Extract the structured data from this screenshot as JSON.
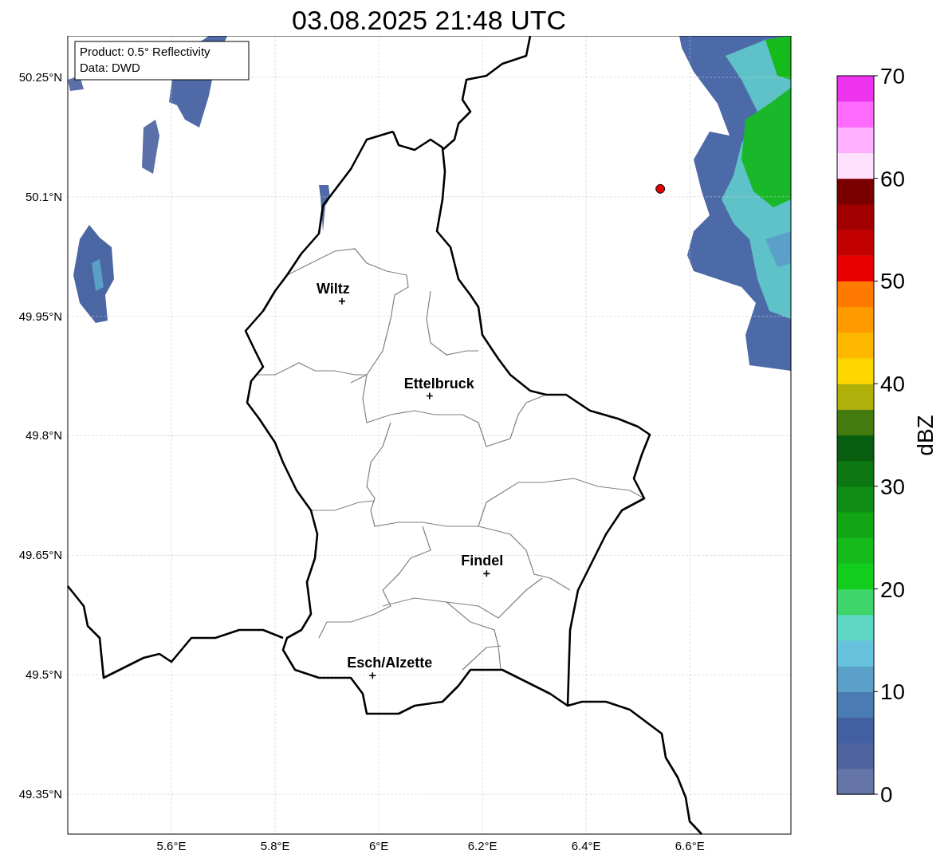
{
  "title": "03.08.2025 21:48 UTC",
  "info_box": [
    "Product: 0.5° Reflectivity",
    "Data: DWD"
  ],
  "map": {
    "chart_data": {
      "type": "scatter",
      "xlim": [
        5.4,
        6.795
      ],
      "ylim": [
        49.3,
        50.302
      ],
      "xticks": [
        {
          "value": 5.6,
          "label": "5.6°E"
        },
        {
          "value": 5.8,
          "label": "5.8°E"
        },
        {
          "value": 6.0,
          "label": "6°E"
        },
        {
          "value": 6.2,
          "label": "6.2°E"
        },
        {
          "value": 6.4,
          "label": "6.4°E"
        },
        {
          "value": 6.6,
          "label": "6.6°E"
        }
      ],
      "yticks": [
        {
          "value": 50.25,
          "label": "50.25°N"
        },
        {
          "value": 50.1,
          "label": "50.1°N"
        },
        {
          "value": 49.95,
          "label": "49.95°N"
        },
        {
          "value": 49.8,
          "label": "49.8°N"
        },
        {
          "value": 49.65,
          "label": "49.65°N"
        },
        {
          "value": 49.5,
          "label": "49.5°N"
        },
        {
          "value": 49.35,
          "label": "49.35°N"
        }
      ],
      "grid": true,
      "series": [
        {
          "color": "#000000",
          "x": [
            5.929,
            6.098,
            6.208,
            5.988
          ],
          "values": [
            49.969,
            49.85,
            49.627,
            49.499
          ]
        },
        {
          "color": "#e00000",
          "x": [
            6.543
          ],
          "values": [
            50.11
          ]
        }
      ],
      "annotations": [
        "Wiltz",
        "Ettelbruck",
        "Findel",
        "Esch/Alzette"
      ]
    }
  },
  "colorbar": {
    "label": "dBZ",
    "ticks": [
      "70",
      "60",
      "50",
      "40",
      "30",
      "20",
      "10",
      "0"
    ],
    "bands": [
      {
        "color": "#6575a7"
      },
      {
        "color": "#4f649e"
      },
      {
        "color": "#4360a2"
      },
      {
        "color": "#4a7cb3"
      },
      {
        "color": "#5ba0c8"
      },
      {
        "color": "#68c2de"
      },
      {
        "color": "#5fd7c5"
      },
      {
        "color": "#3ed66a"
      },
      {
        "color": "#12cc1e"
      },
      {
        "color": "#14bb1a"
      },
      {
        "color": "#12a516"
      },
      {
        "color": "#0f8c14"
      },
      {
        "color": "#0b7612"
      },
      {
        "color": "#065e0e"
      },
      {
        "color": "#457a0f"
      },
      {
        "color": "#b0b00a"
      },
      {
        "color": "#ffd700"
      },
      {
        "color": "#ffb800"
      },
      {
        "color": "#ff9a00"
      },
      {
        "color": "#ff7a00"
      },
      {
        "color": "#e80000"
      },
      {
        "color": "#c20000"
      },
      {
        "color": "#a00000"
      },
      {
        "color": "#7a0000"
      },
      {
        "color": "#ffe0ff"
      },
      {
        "color": "#ffb0ff"
      },
      {
        "color": "#ff6aff"
      },
      {
        "color": "#ee33ee"
      }
    ]
  }
}
